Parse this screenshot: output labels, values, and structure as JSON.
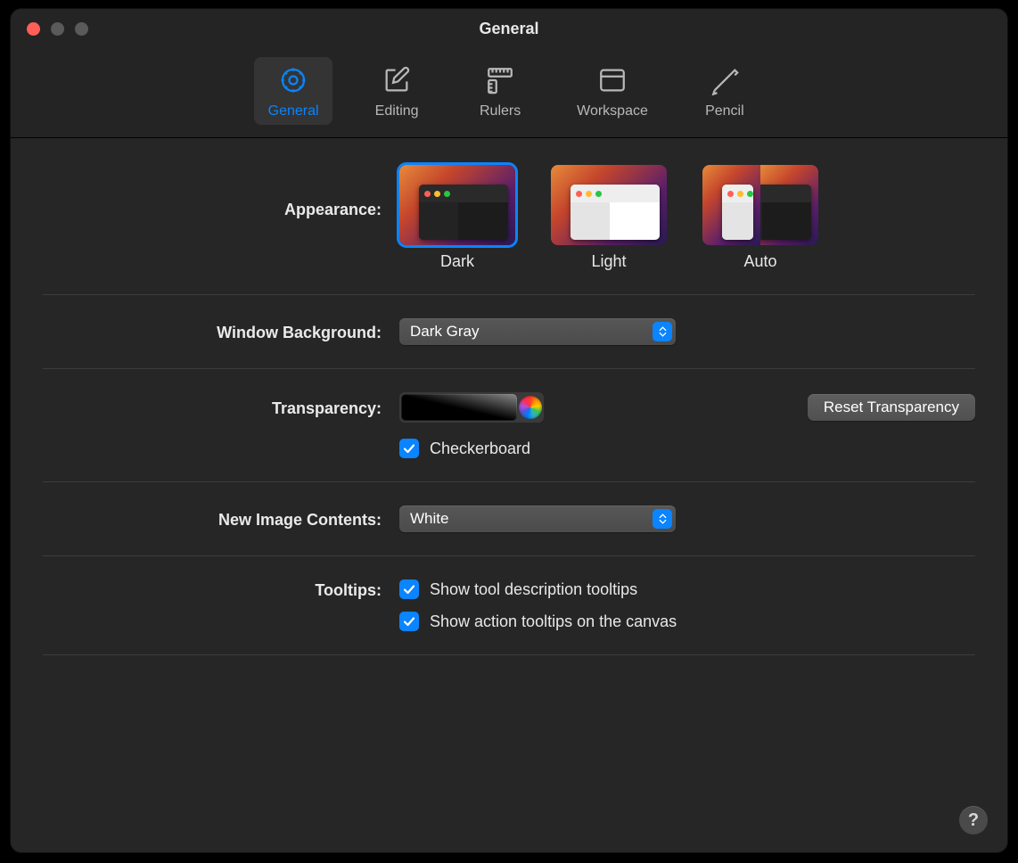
{
  "window": {
    "title": "General"
  },
  "toolbar": {
    "items": [
      {
        "label": "General",
        "selected": true
      },
      {
        "label": "Editing",
        "selected": false
      },
      {
        "label": "Rulers",
        "selected": false
      },
      {
        "label": "Workspace",
        "selected": false
      },
      {
        "label": "Pencil",
        "selected": false
      }
    ]
  },
  "labels": {
    "appearance": "Appearance:",
    "windowBackground": "Window Background:",
    "transparency": "Transparency:",
    "newImageContents": "New Image Contents:",
    "tooltips": "Tooltips:"
  },
  "appearance": {
    "options": [
      {
        "label": "Dark",
        "selected": true
      },
      {
        "label": "Light",
        "selected": false
      },
      {
        "label": "Auto",
        "selected": false
      }
    ]
  },
  "windowBackground": {
    "value": "Dark Gray"
  },
  "transparency": {
    "resetLabel": "Reset Transparency",
    "checkerboard": {
      "checked": true,
      "label": "Checkerboard"
    }
  },
  "newImageContents": {
    "value": "White"
  },
  "tooltips": {
    "items": [
      {
        "checked": true,
        "label": "Show tool description tooltips"
      },
      {
        "checked": true,
        "label": "Show action tooltips on the canvas"
      }
    ]
  },
  "help": "?"
}
